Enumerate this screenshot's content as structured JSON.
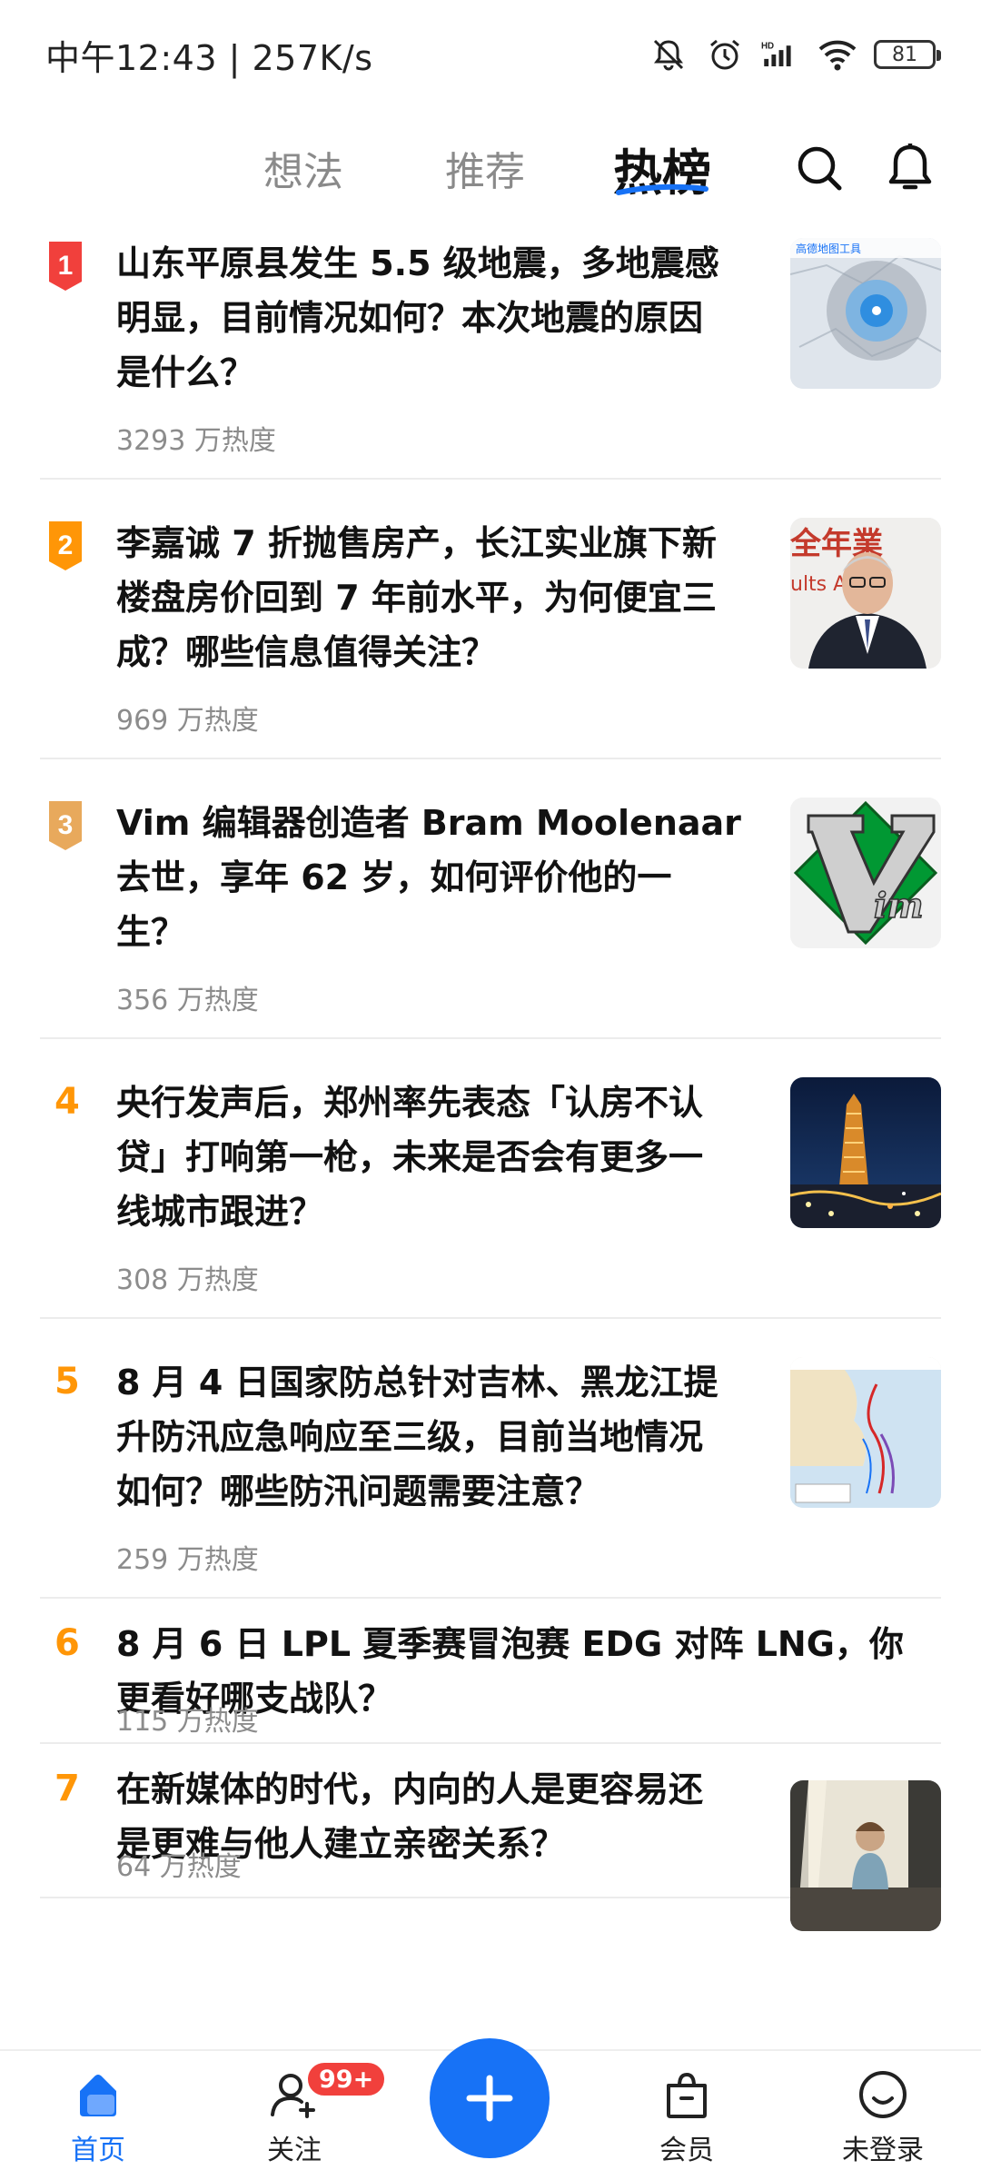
{
  "status_bar": {
    "time_speed": "中午12:43 | 257K/s",
    "battery": "81",
    "icons": [
      "mute-icon",
      "alarm-icon",
      "hd-signal-icon",
      "wifi-icon",
      "battery-icon"
    ]
  },
  "top_nav": {
    "tabs": [
      {
        "label": "想法",
        "active": false
      },
      {
        "label": "推荐",
        "active": false
      },
      {
        "label": "热榜",
        "active": true
      }
    ],
    "icons": [
      "search-icon",
      "bell-icon"
    ]
  },
  "colors": {
    "accent": "#1772f6",
    "rank1": "#f1403c",
    "rank2": "#ff9607",
    "rank3": "#e8a95c",
    "rank_other": "#ff9607",
    "badge": "#f1403c"
  },
  "hot_list": [
    {
      "rank": "1",
      "title_lines": [
        "山东平原县发生 5.5 级地震，多地震感",
        "明显，目前情况如何？本次地震的原因",
        "是什么？"
      ],
      "heat": "3293 万热度",
      "thumb": "earthquake-map-thumb"
    },
    {
      "rank": "2",
      "title_lines": [
        "李嘉诚 7 折抛售房产，长江实业旗下新",
        "楼盘房价回到 7 年前水平，为何便宜三",
        "成？哪些信息值得关注？"
      ],
      "heat": "969 万热度",
      "thumb": "man-portrait-thumb"
    },
    {
      "rank": "3",
      "title_lines": [
        "Vim 编辑器创造者 Bram Moolenaar",
        "去世，享年 62 岁，如何评价他的一",
        "生？"
      ],
      "heat": "356 万热度",
      "thumb": "vim-logo-thumb"
    },
    {
      "rank": "4",
      "title_lines": [
        "央行发声后，郑州率先表态「认房不认",
        "贷」打响第一枪，未来是否会有更多一",
        "线城市跟进？"
      ],
      "heat": "308 万热度",
      "thumb": "city-night-thumb"
    },
    {
      "rank": "5",
      "title_lines": [
        "8 月 4 日国家防总针对吉林、黑龙江提",
        "升防汛应急响应至三级，目前当地情况",
        "如何？哪些防汛问题需要注意？"
      ],
      "heat": "259 万热度",
      "thumb": "typhoon-map-thumb"
    },
    {
      "rank": "6",
      "title_lines": [
        "8 月 6 日 LPL 夏季赛冒泡赛 EDG 对阵 LNG，你",
        "更看好哪支战队？"
      ],
      "heat": "115 万热度",
      "thumb": ""
    },
    {
      "rank": "7",
      "title_lines": [
        "在新媒体的时代，内向的人是更容易还",
        "是更难与他人建立亲密关系？"
      ],
      "heat": "64 万热度",
      "thumb": "child-window-thumb"
    }
  ],
  "thumb_texts": {
    "earthquake_map_caption": "高德地图工具",
    "portrait_bg_text_top": "全年業",
    "portrait_bg_text_mid": "ults  Anou"
  },
  "bottom_nav": {
    "items": [
      {
        "label": "首页",
        "icon": "home-icon",
        "active": true
      },
      {
        "label": "关注",
        "icon": "follow-icon",
        "active": false
      },
      {
        "label": "会员",
        "icon": "vip-bag-icon",
        "active": false
      },
      {
        "label": "未登录",
        "icon": "profile-icon",
        "active": false
      }
    ],
    "badge": "99+",
    "fab_icon": "plus-icon"
  }
}
